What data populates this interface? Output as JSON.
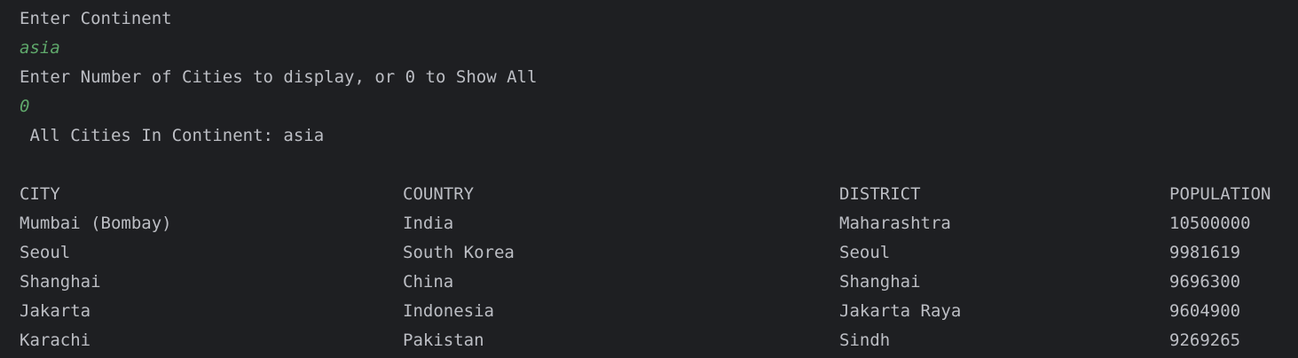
{
  "console": {
    "prompt_continent": "Enter Continent",
    "input_continent": "asia",
    "prompt_count": "Enter Number of Cities to display, or 0 to Show All",
    "input_count": "0",
    "result_heading": " All Cities In Continent: asia"
  },
  "table": {
    "headers": {
      "city": "CITY",
      "country": "COUNTRY",
      "district": "DISTRICT",
      "population": "POPULATION"
    },
    "rows": [
      {
        "city": "Mumbai (Bombay)",
        "country": "India",
        "district": "Maharashtra",
        "population": "10500000"
      },
      {
        "city": "Seoul",
        "country": "South Korea",
        "district": "Seoul",
        "population": "9981619"
      },
      {
        "city": "Shanghai",
        "country": "China",
        "district": "Shanghai",
        "population": "9696300"
      },
      {
        "city": "Jakarta",
        "country": "Indonesia",
        "district": "Jakarta Raya",
        "population": "9604900"
      },
      {
        "city": "Karachi",
        "country": "Pakistan",
        "district": "Sindh",
        "population": "9269265"
      }
    ]
  },
  "colors": {
    "background": "#1e1f22",
    "text": "#bcbec4",
    "user_input": "#5fa86b"
  }
}
